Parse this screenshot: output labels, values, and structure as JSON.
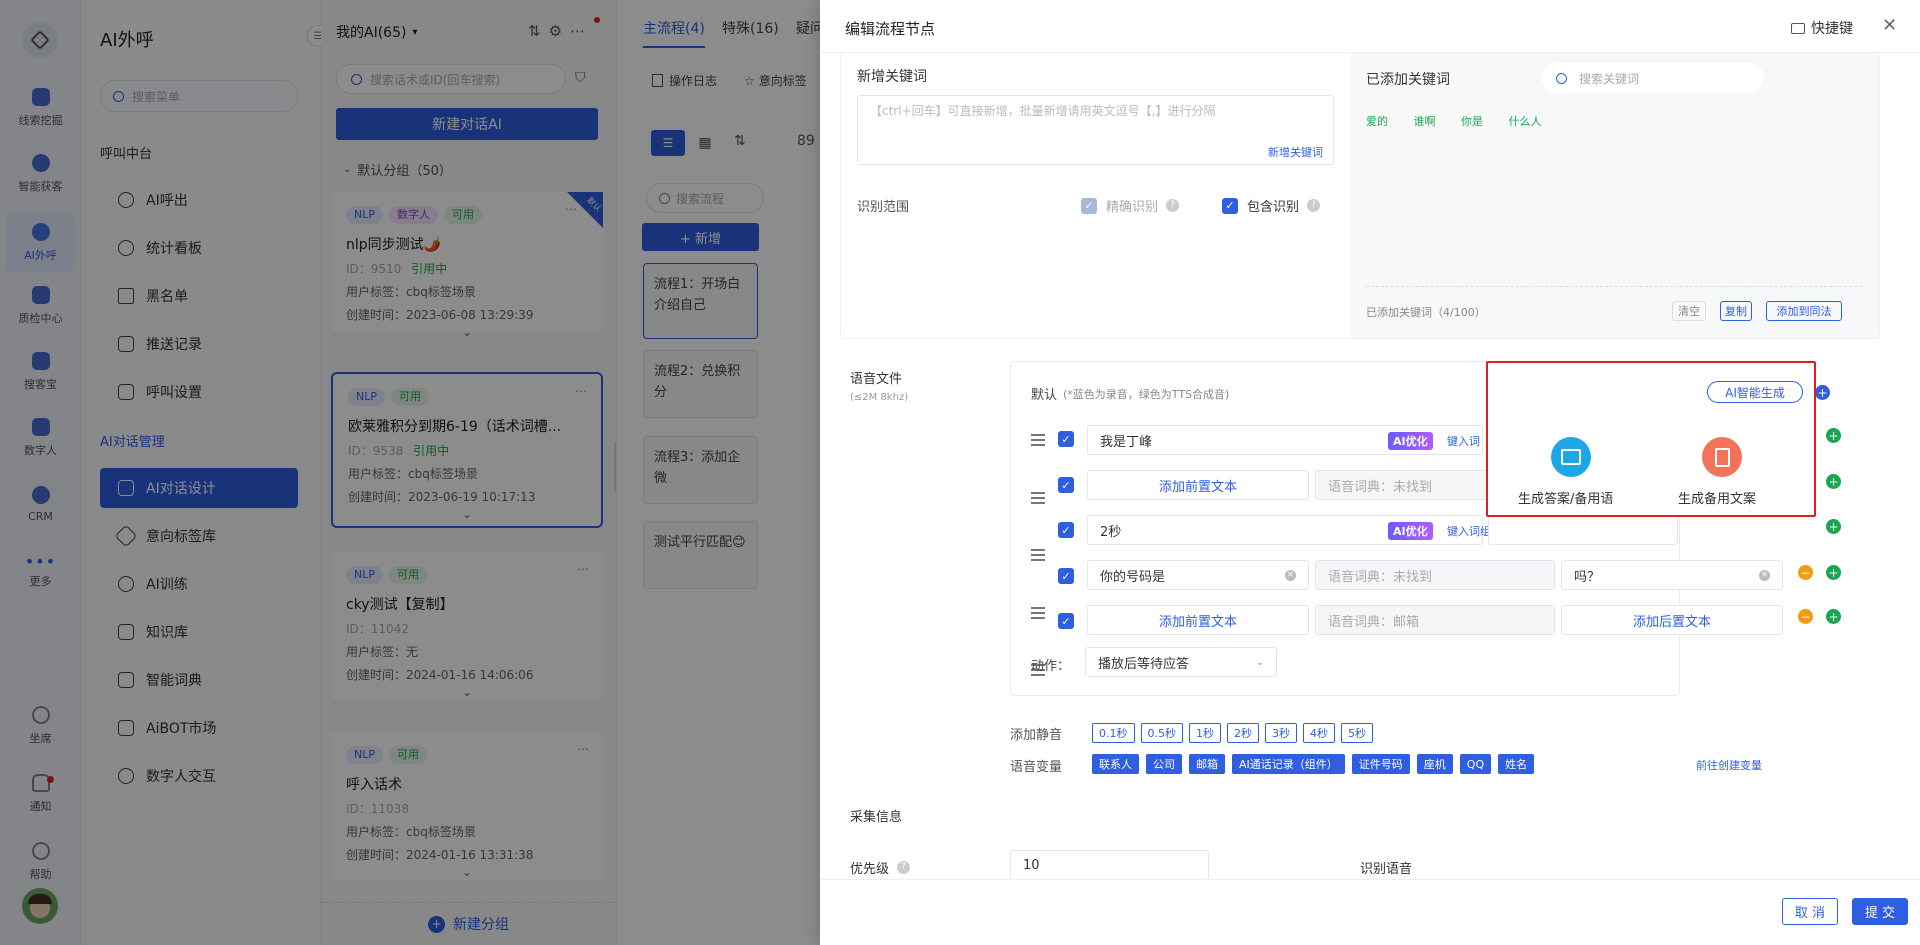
{
  "rail": {
    "items": [
      {
        "label": "线索挖掘",
        "icon": "data-mining-icon"
      },
      {
        "label": "智能获客",
        "icon": "customer-acquisition-icon"
      },
      {
        "label": "AI外呼",
        "icon": "ai-call-icon",
        "active": true
      },
      {
        "label": "质检中心",
        "icon": "quality-check-icon"
      },
      {
        "label": "搜客宝",
        "icon": "search-customer-icon"
      },
      {
        "label": "数字人",
        "icon": "digital-human-icon"
      },
      {
        "label": "CRM",
        "icon": "crm-icon"
      },
      {
        "label": "更多",
        "icon": "more-icon"
      }
    ],
    "bottom": [
      {
        "label": "坐席",
        "icon": "headset-icon"
      },
      {
        "label": "通知",
        "icon": "bell-icon"
      },
      {
        "label": "帮助",
        "icon": "help-icon"
      }
    ]
  },
  "menu": {
    "title": "AI外呼",
    "search_placeholder": "搜索菜单",
    "group1": "呼叫中台",
    "group1_items": [
      "AI呼出",
      "统计看板",
      "黑名单",
      "推送记录",
      "呼叫设置"
    ],
    "group2": "AI对话管理",
    "group2_items": [
      "AI对话设计",
      "意向标签库",
      "AI训练",
      "知识库",
      "智能词典",
      "AiBOT市场",
      "数字人交互"
    ]
  },
  "list": {
    "dropdown": "我的AI(65)",
    "search_placeholder": "搜索话术或ID(回车搜索)",
    "new_button": "新建对话AI",
    "group_label": "默认分组（50）",
    "new_group": "新建分组",
    "cards": [
      {
        "tags": [
          "NLP",
          "数字人",
          "可用"
        ],
        "title": "nlp同步测试🌶️",
        "id": "ID：9510",
        "status": "引用中",
        "user_tag": "用户标签：cbq标签场景",
        "created": "创建时间：2023-06-08 13:29:39",
        "corner": "默认"
      },
      {
        "tags": [
          "NLP",
          "可用"
        ],
        "title": "欧莱雅积分到期6-19（话术词槽...",
        "id": "ID：9538",
        "status": "引用中",
        "user_tag": "用户标签：cbq标签场景",
        "created": "创建时间：2023-06-19 10:17:13"
      },
      {
        "tags": [
          "NLP",
          "可用"
        ],
        "title": "cky测试【复制】",
        "id": "ID：11042",
        "status": "",
        "user_tag": "用户标签：无",
        "created": "创建时间：2024-01-16 14:06:06"
      },
      {
        "tags": [
          "NLP",
          "可用"
        ],
        "title": "呼入话术",
        "id": "ID：11038",
        "status": "",
        "user_tag": "用户标签：cbq标签场景",
        "created": "创建时间：2024-01-16 13:31:38"
      }
    ]
  },
  "flow": {
    "tabs": [
      "主流程(4)",
      "特殊(16)",
      "疑问"
    ],
    "toolbar": [
      "操作日志",
      "意向标签"
    ],
    "search_placeholder": "搜索流程",
    "add_button": "+ 新增",
    "percent": "89",
    "nodes": [
      "流程1：开场白介绍自己",
      "流程2：兑换积分",
      "流程3：添加企微",
      "测试平行匹配😊"
    ]
  },
  "drawer": {
    "title": "编辑流程节点",
    "shortcut": "快捷键",
    "kw": {
      "new_label": "新增关键词",
      "textarea_placeholder": "【ctrl+回车】可直接新增，批量新增请用英文逗号【,】进行分隔",
      "add_link": "新增关键词",
      "scope_label": "识别范围",
      "exact": "精确识别",
      "contains": "包含识别",
      "added_label": "已添加关键词",
      "search_placeholder": "搜索关键词",
      "added_tags": [
        "爱的",
        "谁啊",
        "你是",
        "什么人"
      ],
      "count": "已添加关键词（4/100）",
      "btn_clear": "清空",
      "btn_copy": "复制",
      "btn_add_syn": "添加到同法"
    },
    "voice": {
      "label": "语音文件",
      "sub": "(≤2M 8khz)",
      "default": "默认",
      "note": "(*蓝色为录音，绿色为TTS合成音)",
      "ai_gen": "AI智能生成",
      "rows": [
        {
          "text": "我是丁峰",
          "ai": "AI优化",
          "link": "键入词",
          "type": "text"
        },
        {
          "pre": "添加前置文本",
          "dict": "语音词典：未找到",
          "type": "pre"
        },
        {
          "text": "2秒",
          "ai": "AI优化",
          "link": "键入词组",
          "type": "text"
        },
        {
          "text": "你的号码是",
          "dict": "语音词典：未找到",
          "post_val": "吗？",
          "type": "var"
        },
        {
          "pre": "添加前置文本",
          "dict": "语音词典：邮箱",
          "post": "添加后置文本",
          "type": "both"
        }
      ],
      "action_label": "动作：",
      "action_value": "播放后等待应答"
    },
    "popup": {
      "ai_button": "AI智能生成",
      "opt1": "生成答案/备用语",
      "opt2": "生成备用文案"
    },
    "silence": {
      "label": "添加静音",
      "buttons": [
        "0.1秒",
        "0.5秒",
        "1秒",
        "2秒",
        "3秒",
        "4秒",
        "5秒"
      ]
    },
    "vars": {
      "label": "语音变量",
      "buttons": [
        "联系人",
        "公司",
        "邮箱",
        "AI通话记录（组件）",
        "证件号码",
        "座机",
        "QQ",
        "姓名"
      ],
      "create": "前往创建变量"
    },
    "collect": "采集信息",
    "priority": {
      "label": "优先级",
      "value": "10"
    },
    "recog": "识别语音",
    "cancel": "取 消",
    "submit": "提 交",
    "colors": {
      "accent": "#2f5ee0",
      "green": "#1aa550",
      "highlight": "#e02020"
    }
  }
}
